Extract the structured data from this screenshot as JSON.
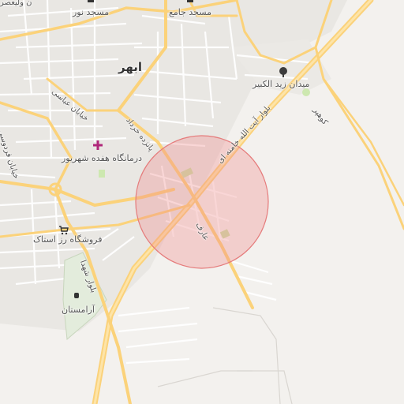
{
  "map": {
    "city_label": "ابهر",
    "places": {
      "mosque_noor": "مسجد نور",
      "mosque_jame": "مسجد جامع",
      "square": "میدان زید الکبیر",
      "clinic": "درمانگاه هفده شهریور",
      "store": "فروشگاه رز استاک",
      "cemetery": "آرامستان",
      "top_left_partial": "ن ولیعصر"
    },
    "roads": {
      "boulevard_khamenei": "بلوار آیت الله خامنه ای",
      "street_khordad": "پانزده خرداد",
      "street_abbasi": "خیابان عباسی",
      "street_ferdowsi": "خیابان فردوسی",
      "boulevard_shohada": "بلوار شهدا",
      "street_aref": "عارف",
      "road_kohpar": "کوهپر"
    },
    "highlight": {
      "shape": "circle",
      "color": "#f28b8b"
    },
    "colors": {
      "background": "#f3f1ee",
      "major_road": "#fbd27a",
      "minor_road": "#ffffff",
      "green": "#cde8b0"
    }
  }
}
